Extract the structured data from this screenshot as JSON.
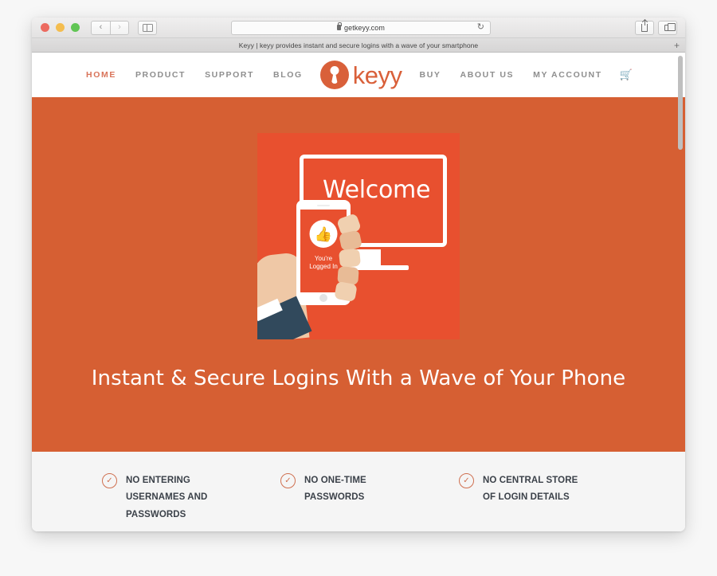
{
  "browser": {
    "traffic_lights": [
      "close",
      "minimize",
      "maximize"
    ],
    "back_label": "‹",
    "forward_label": "›",
    "sidebar_toggle_name": "sidebar-toggle",
    "url": "getkeyy.com",
    "reload_label": "↻",
    "tab_title": "Keyy | keyy provides instant and secure logins with a wave of your smartphone",
    "new_tab_label": "+",
    "share_icon": "share-icon",
    "tabs_icon": "show-tabs-icon"
  },
  "site": {
    "nav_left": [
      {
        "label": "HOME",
        "active": true
      },
      {
        "label": "PRODUCT",
        "active": false
      },
      {
        "label": "SUPPORT",
        "active": false
      },
      {
        "label": "BLOG",
        "active": false
      }
    ],
    "logo": {
      "text": "keyy",
      "mark": "keyhole-icon"
    },
    "nav_right": [
      {
        "label": "BUY"
      },
      {
        "label": "ABOUT US"
      },
      {
        "label": "MY ACCOUNT"
      }
    ],
    "cart_icon": "🛒"
  },
  "hero": {
    "title": "Instant & Secure Logins With a Wave of Your Phone",
    "art": {
      "monitor_text": "Welcome",
      "phone_caption_line1": "You're",
      "phone_caption_line2": "Logged In",
      "thumb_icon": "👍"
    }
  },
  "features": [
    {
      "check": "✓",
      "text": "NO ENTERING\nUSERNAMES AND\nPASSWORDS"
    },
    {
      "check": "✓",
      "text": "NO ONE-TIME\nPASSWORDS"
    },
    {
      "check": "✓",
      "text": "NO CENTRAL STORE\nOF LOGIN DETAILS"
    }
  ],
  "colors": {
    "hero_orange": "#d65f33",
    "art_red": "#e8502f",
    "brand_orange": "#d9603a",
    "accent_link": "#d9745a",
    "feature_bg": "#f5f5f5",
    "text_dark": "#3b4149"
  }
}
